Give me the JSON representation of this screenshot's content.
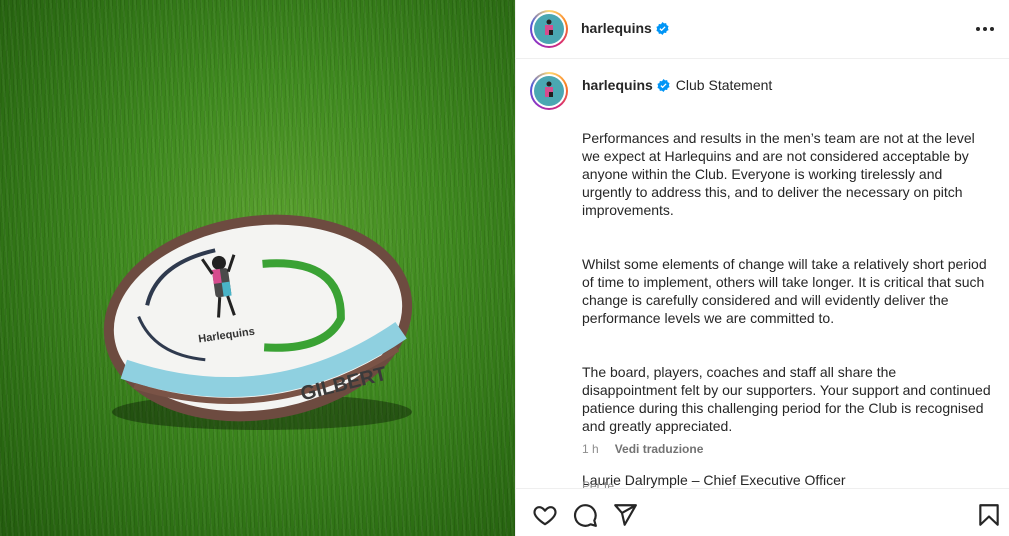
{
  "post": {
    "username": "harlequins",
    "verified": true,
    "caption_title": "Club Statement",
    "caption_paragraphs": [
      "Performances and results in the men’s team are not at the level we expect at Harlequins and are not considered acceptable by anyone within the Club. Everyone is working tirelessly and urgently to address this, and to deliver the necessary on pitch improvements.",
      "Whilst some elements of change will take a relatively short period of time to implement, others will take longer. It is critical that such change is carefully considered and will evidently deliver the performance levels we are committed to.",
      "The board, players, coaches and staff all share the disappointment felt by our supporters. Your support and continued patience during this challenging period for the Club is recognised and greatly appreciated.",
      "Laurie Dalrymple – Chief Executive Officer\nDavid Morgan - Chairman"
    ],
    "time_ago": "1 h",
    "translate_label": "Vedi traduzione",
    "next_comment_partial": "Per te ..."
  },
  "media": {
    "ball_text": "Harlequins",
    "ball_brand": "GILBERT"
  },
  "icons": {
    "more": "more-options-icon",
    "like": "heart-icon",
    "comment": "comment-icon",
    "share": "send-icon",
    "save": "bookmark-icon"
  },
  "colors": {
    "verified": "#0095f6",
    "text": "#262626",
    "muted": "#8e8e8e",
    "logo_bg": "#4aa7b2"
  }
}
